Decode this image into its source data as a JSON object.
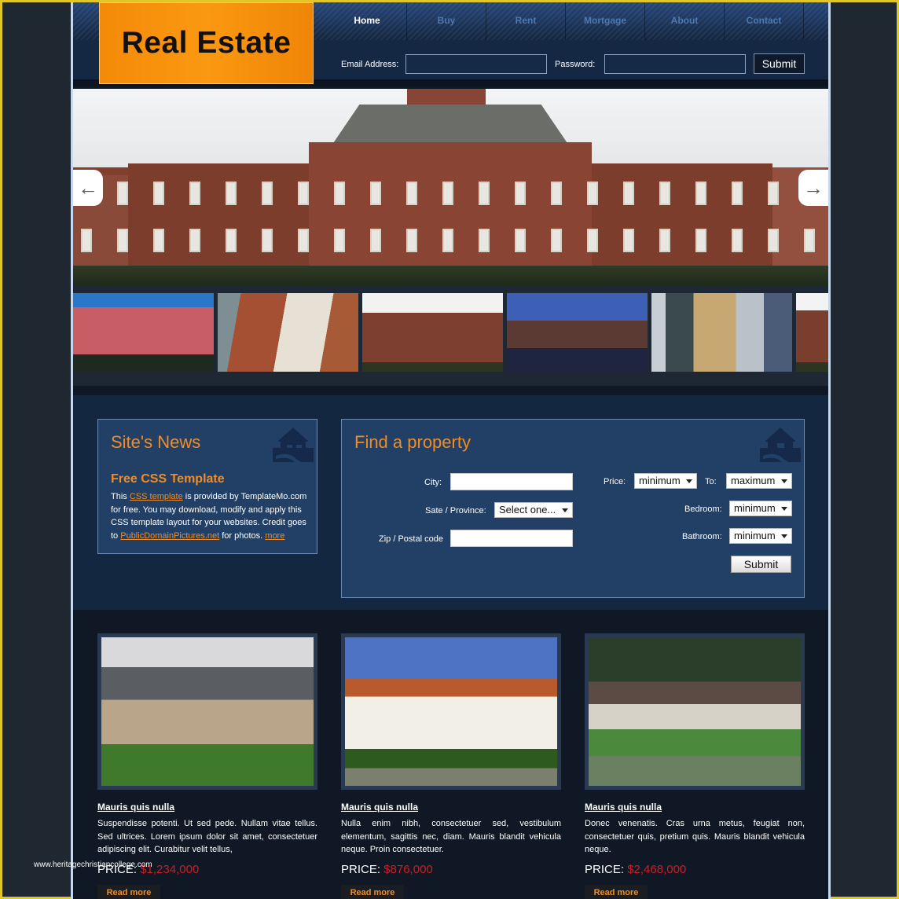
{
  "header": {
    "logo_text": "Real Estate",
    "nav": [
      {
        "label": "Home",
        "active": true
      },
      {
        "label": "Buy",
        "active": false
      },
      {
        "label": "Rent",
        "active": false
      },
      {
        "label": "Mortgage",
        "active": false
      },
      {
        "label": "About",
        "active": false
      },
      {
        "label": "Contact",
        "active": false
      }
    ],
    "login": {
      "email_label": "Email Address:",
      "email_value": "",
      "password_label": "Password:",
      "password_value": "",
      "submit_label": "Submit"
    }
  },
  "slider": {
    "prev_icon": "arrow-left-icon",
    "next_icon": "arrow-right-icon",
    "thumbnails": [
      "pink-palace",
      "old-town-houses",
      "brick-manor",
      "night-bridge",
      "city-skyline",
      "brick-manor-partial"
    ]
  },
  "news": {
    "title": "Site's News",
    "icon": "house-icon",
    "heading": "Free CSS Template",
    "text_1": "This ",
    "link_1": "CSS template",
    "text_2": " is provided by TemplateMo.com for free. You may download, modify and apply this CSS template layout for your websites. Credit goes to ",
    "link_2": "PublicDomainPictures.net",
    "text_3": " for photos. ",
    "link_3": "more"
  },
  "find": {
    "title": "Find a property",
    "icon": "house-icon",
    "city_label": "City:",
    "city_value": "",
    "state_label": "Sate / Province:",
    "state_selected": "Select one...",
    "zip_label": "Zip / Postal code",
    "zip_value": "",
    "price_label": "Price:",
    "price_min_selected": "minimum",
    "to_label": "To:",
    "price_max_selected": "maximum",
    "bedroom_label": "Bedroom:",
    "bedroom_selected": "minimum",
    "bathroom_label": "Bathroom:",
    "bathroom_selected": "minimum",
    "submit_label": "Submit"
  },
  "listings": [
    {
      "title": "Mauris quis nulla",
      "description": "Suspendisse potenti. Ut sed pede. Nullam vitae tellus. Sed ultrices. Lorem ipsum dolor sit amet, consectetuer adipiscing elit. Curabitur velit tellus,",
      "price_label": "PRICE:",
      "price": "$1,234,000",
      "read_more": "Read more"
    },
    {
      "title": "Mauris quis nulla",
      "description": "Nulla enim nibh, consectetuer sed, vestibulum elementum, sagittis nec, diam. Mauris blandit vehicula neque. Proin consectetuer.",
      "price_label": "PRICE:",
      "price": "$876,000",
      "read_more": "Read more"
    },
    {
      "title": "Mauris quis nulla",
      "description": "Donec venenatis. Cras urna metus, feugiat non, consectetuer quis, pretium quis. Mauris blandit vehicula neque.",
      "price_label": "PRICE:",
      "price": "$2,468,000",
      "read_more": "Read more"
    }
  ],
  "watermark": "www.heritagechristiancollege.com",
  "colors": {
    "accent_orange": "#f08c25",
    "price_red": "#d01d22",
    "frame_yellow": "#e2c628",
    "panel_blue": "#224066"
  }
}
